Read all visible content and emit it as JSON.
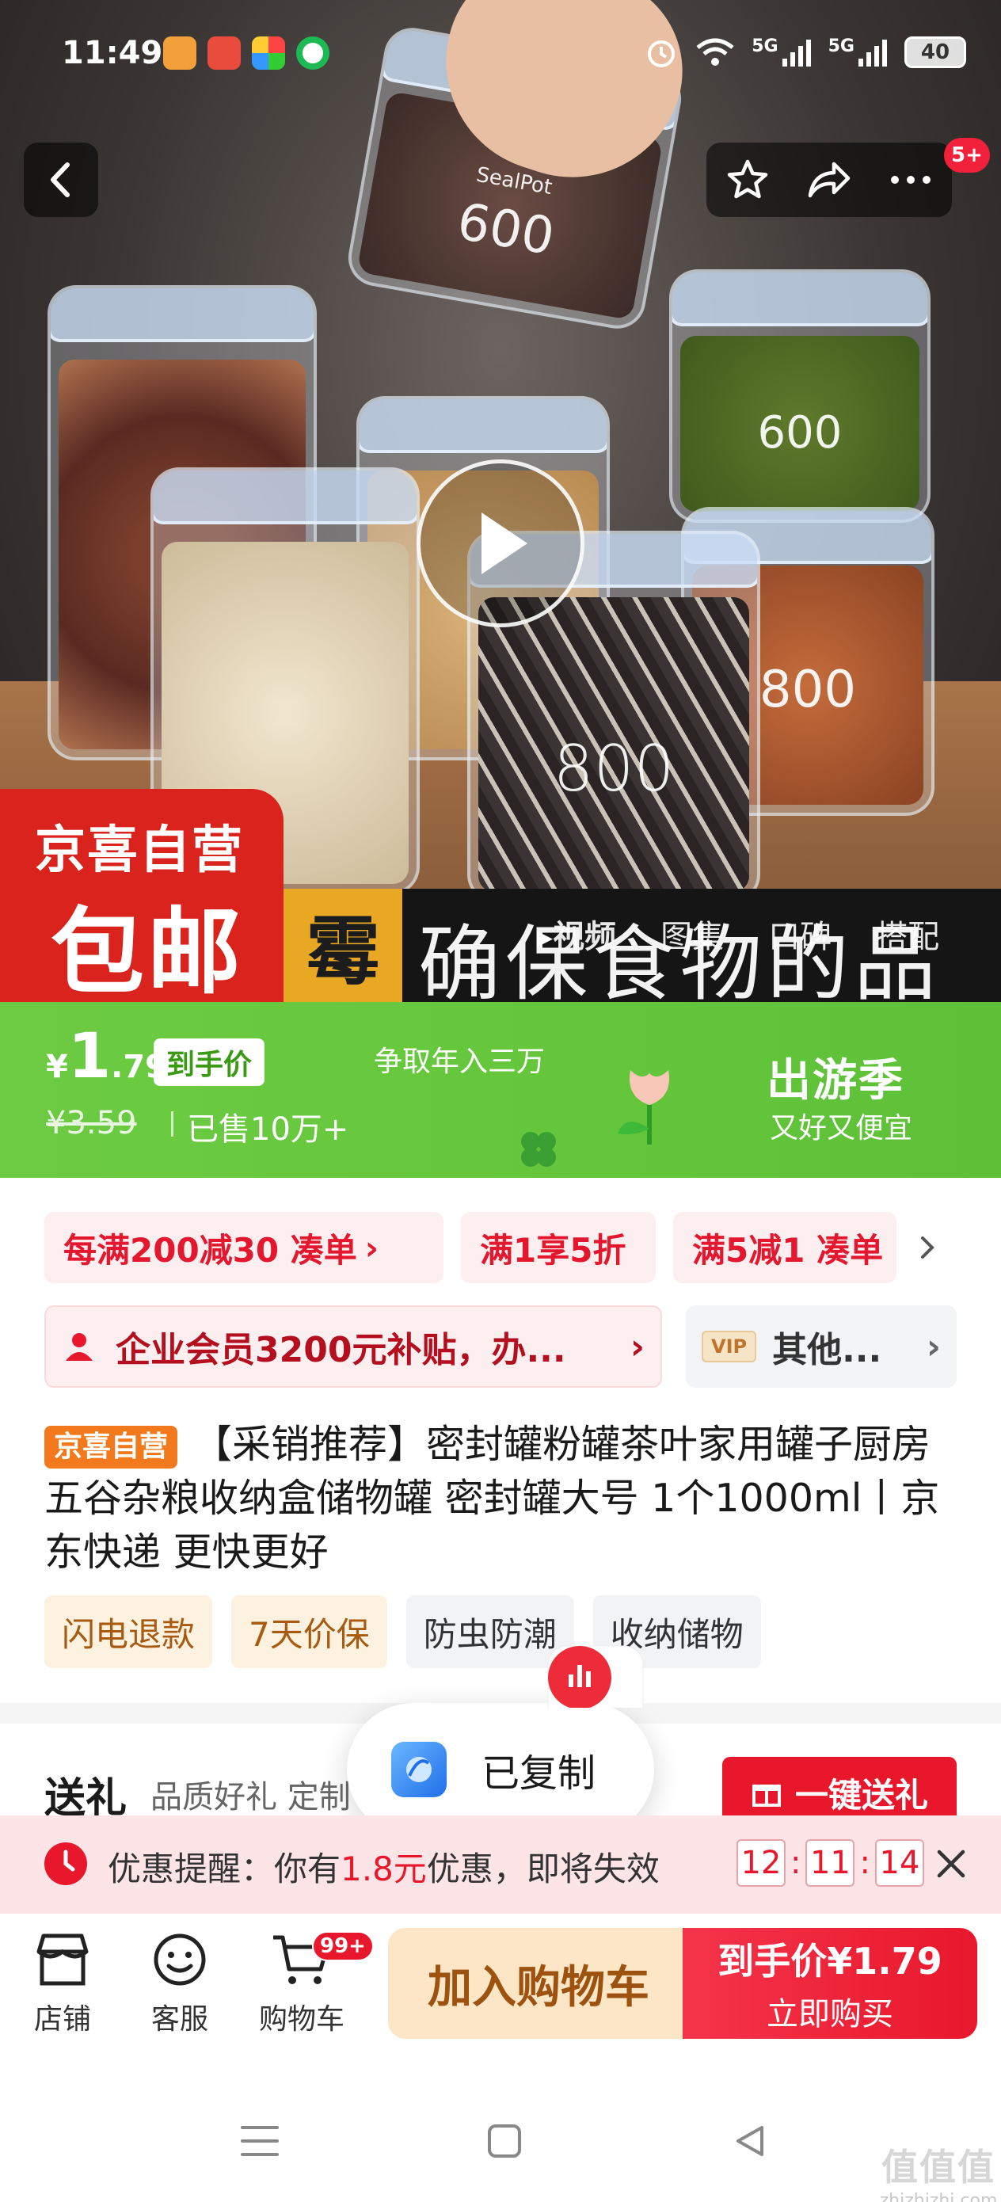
{
  "status_bar": {
    "time": "11:49",
    "net1": "5G",
    "net2": "5G",
    "battery": "40"
  },
  "header": {
    "cart_badge": "5+"
  },
  "hero": {
    "jar_labels": [
      "SealPot",
      "600",
      "800",
      "800",
      "600"
    ],
    "ad_left_line1": "京喜自营",
    "ad_left_line2": "包邮",
    "ad_strip_mold": "霉",
    "ad_strip_text": "确保食物的品质",
    "media_tabs": [
      "视频",
      "图集",
      "口碑",
      "搭配"
    ]
  },
  "price_banner": {
    "currency": "¥",
    "price_int": "1",
    "price_dec": ".79",
    "price_tag": "到手价",
    "slogan": "争取年入三万",
    "original_price": "¥3.59",
    "sold": "已售10万+",
    "season_title": "出游季",
    "season_sub": "又好又便宜"
  },
  "coupons": [
    "每满200减30 凑单",
    "满1享5折",
    "满5减1 凑单"
  ],
  "member": {
    "text": "企业会员3200元补贴，办...",
    "vip_tag": "VIP",
    "other": "其他..."
  },
  "product": {
    "self_tag": "京喜自营",
    "title": "【采销推荐】密封罐粉罐茶叶家用罐子厨房五谷杂粮收纳盒储物罐 密封罐大号 1个1000ml丨京东快递 更快更好",
    "chips": [
      "闪电退款",
      "7天价保",
      "防虫防潮",
      "收纳储物"
    ]
  },
  "gift": {
    "title": "送礼",
    "subtitle": "品质好礼 定制",
    "button": "一键送礼"
  },
  "toast": {
    "text": "已复制"
  },
  "reminder": {
    "prefix": "优惠提醒：你有",
    "amount": "1.8元",
    "suffix": "优惠，即将失效",
    "hh": "12",
    "mm": "11",
    "ss": "14",
    "sep": ":"
  },
  "bottom_bar": {
    "shop": "店铺",
    "service": "客服",
    "cart": "购物车",
    "cart_badge": "99+",
    "add_cart": "加入购物车",
    "buy_line1": "到手价¥1.79",
    "buy_line2": "立即购买"
  },
  "watermark": {
    "line1": "值值值",
    "line2": "zhizhizhi.com"
  },
  "colors": {
    "jd_red": "#e8172c",
    "green_banner": "#64c63b",
    "orange_tag": "#f27a1d"
  }
}
